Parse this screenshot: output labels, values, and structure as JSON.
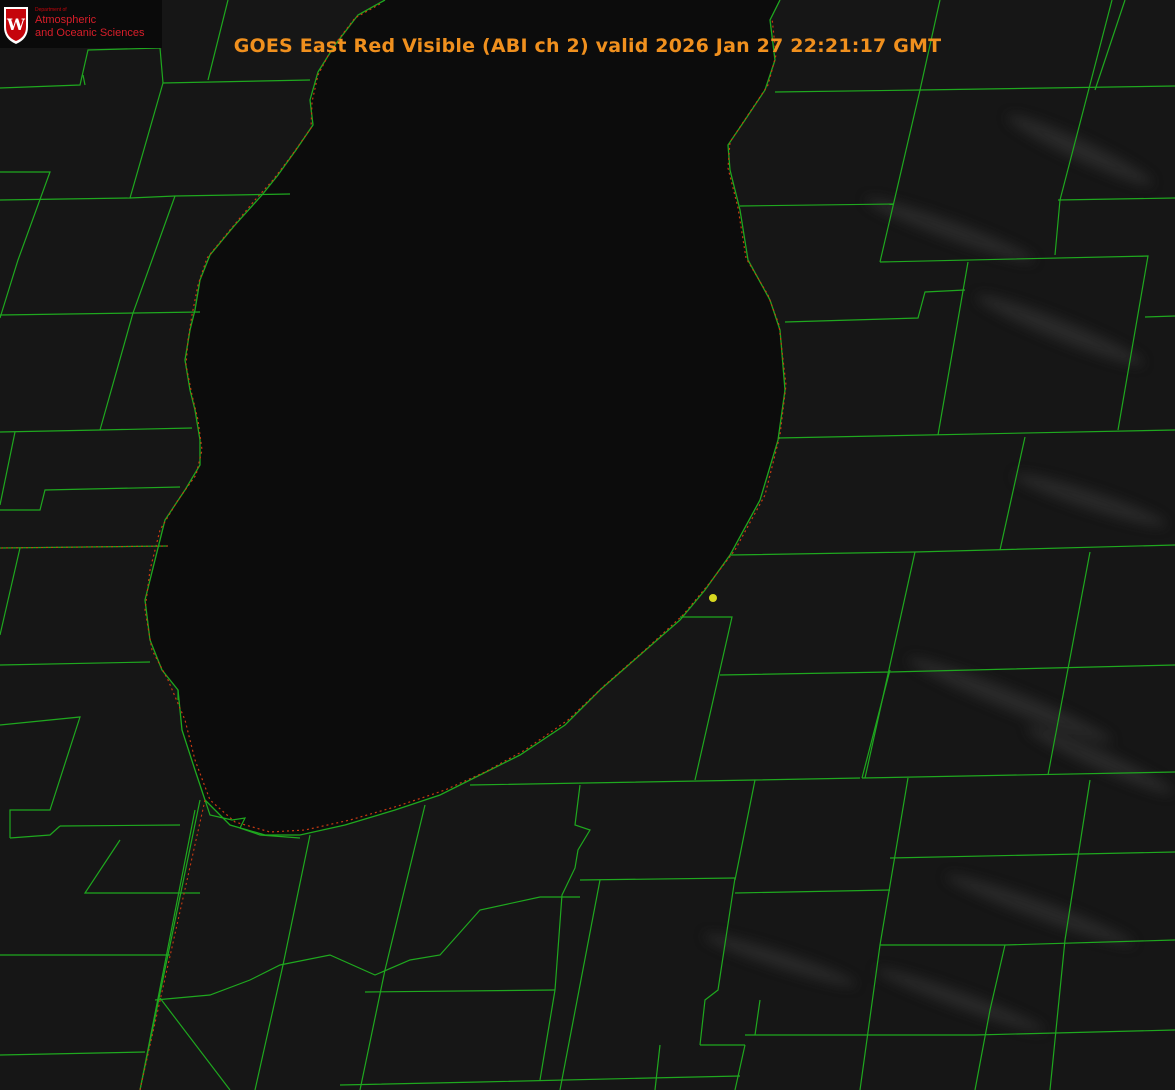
{
  "title": "GOES East Red Visible (ABI ch 2) valid 2026 Jan 27 22:21:17 GMT",
  "logo": {
    "department": "Department of",
    "line1": "Atmospheric",
    "line2": "and Oceanic Sciences",
    "crest_letter": "W"
  },
  "colors": {
    "background": "#161616",
    "lake": "#0c0c0c",
    "county_lines": "#1fa81f",
    "state_border": "#c83a12",
    "title": "#f0901e",
    "marker": "#d8d820"
  },
  "icons": [
    "uw-crest-icon",
    "station-marker-icon"
  ]
}
